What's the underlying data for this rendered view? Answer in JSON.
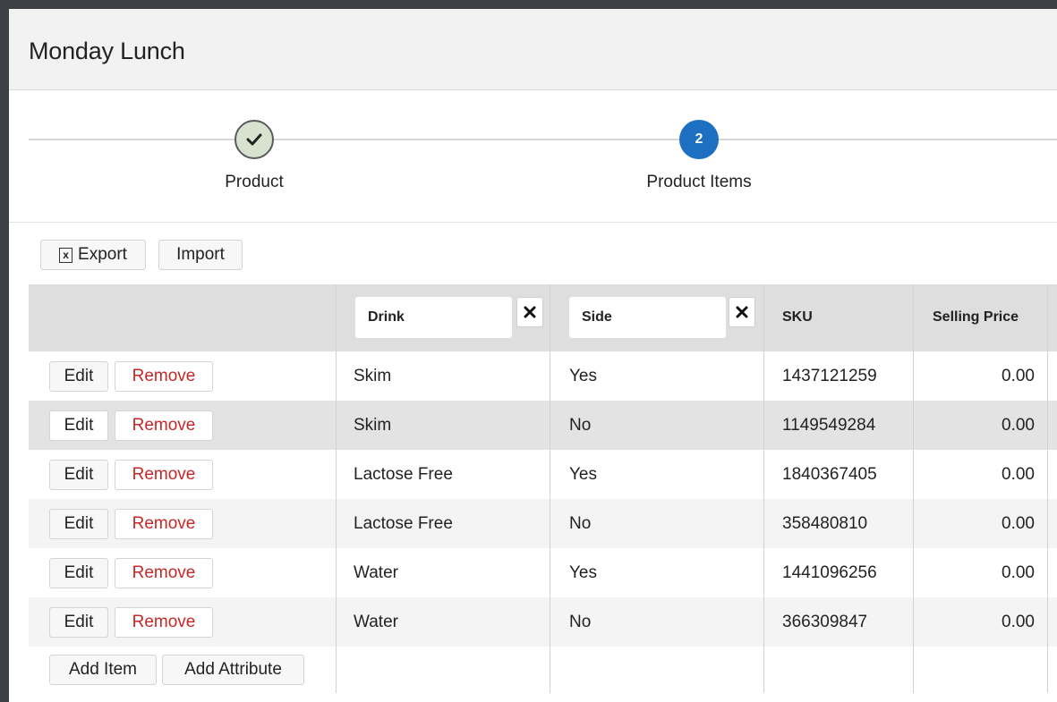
{
  "header": {
    "title": "Monday Lunch"
  },
  "stepper": {
    "steps": [
      {
        "number": "1",
        "label": "Product",
        "state": "done",
        "icon": "check-icon"
      },
      {
        "number": "2",
        "label": "Product Items",
        "state": "current"
      }
    ]
  },
  "toolbar": {
    "export_label": "Export",
    "export_icon": "excel-file-icon",
    "import_label": "Import"
  },
  "table": {
    "filters": [
      {
        "label": "Drink",
        "clear_icon": "close-icon"
      },
      {
        "label": "Side",
        "clear_icon": "close-icon"
      }
    ],
    "columns": {
      "sku": "SKU",
      "selling_price": "Selling Price"
    },
    "row_actions": {
      "edit": "Edit",
      "remove": "Remove"
    },
    "rows": [
      {
        "drink": "Skim",
        "side": "Yes",
        "sku": "1437121259",
        "price": "0.00"
      },
      {
        "drink": "Skim",
        "side": "No",
        "sku": "1149549284",
        "price": "0.00"
      },
      {
        "drink": "Lactose Free",
        "side": "Yes",
        "sku": "1840367405",
        "price": "0.00"
      },
      {
        "drink": "Lactose Free",
        "side": "No",
        "sku": "358480810",
        "price": "0.00"
      },
      {
        "drink": "Water",
        "side": "Yes",
        "sku": "1441096256",
        "price": "0.00"
      },
      {
        "drink": "Water",
        "side": "No",
        "sku": "366309847",
        "price": "0.00"
      }
    ],
    "footer": {
      "add_item": "Add Item",
      "add_attribute": "Add Attribute"
    }
  },
  "colors": {
    "accent": "#1d6fc1",
    "danger": "#c62828",
    "done_step": "#d8e3cf"
  }
}
